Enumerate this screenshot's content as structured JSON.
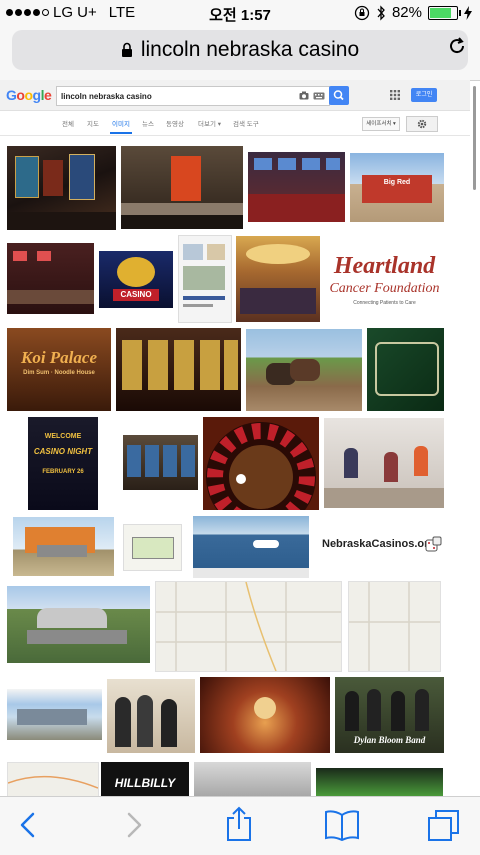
{
  "status": {
    "carrier": "LG U+",
    "network": "LTE",
    "time": "오전 1:57",
    "battery_percent": 82,
    "battery_text": "82%"
  },
  "browser": {
    "url_text": "lincoln nebraska casino"
  },
  "google": {
    "logo_letters": [
      "G",
      "o",
      "o",
      "g",
      "l",
      "e"
    ],
    "logo_colors": [
      "#4285f4",
      "#ea4335",
      "#fbbc05",
      "#4285f4",
      "#34a853",
      "#ea4335"
    ],
    "query": "lincoln nebraska casino",
    "login_label": "로그인",
    "tabs": [
      "전체",
      "지도",
      "이미지",
      "뉴스",
      "동영상",
      "더보기 ▾",
      "검색 도구"
    ],
    "active_tab": "이미지",
    "safesearch_label": "세이프서치 ▾"
  },
  "results": {
    "labels": {
      "big_red": "Big Red",
      "casino_sign": "CASINO",
      "heartland_line1": "Heartland",
      "heartland_line2": "Cancer Foundation",
      "heartland_tagline": "Connecting Patients to Care",
      "koi_line1": "Koi Palace",
      "koi_line2": "Dim Sum · Noodle House",
      "welcome": "WELCOME",
      "casino_night": "CASINO NIGHT",
      "february": "FEBRUARY 26",
      "nebraska_casinos": "NebraskaCasinos.org",
      "band": "Dylan Bloom Band",
      "hillbilly": "HILLBILLY"
    }
  }
}
